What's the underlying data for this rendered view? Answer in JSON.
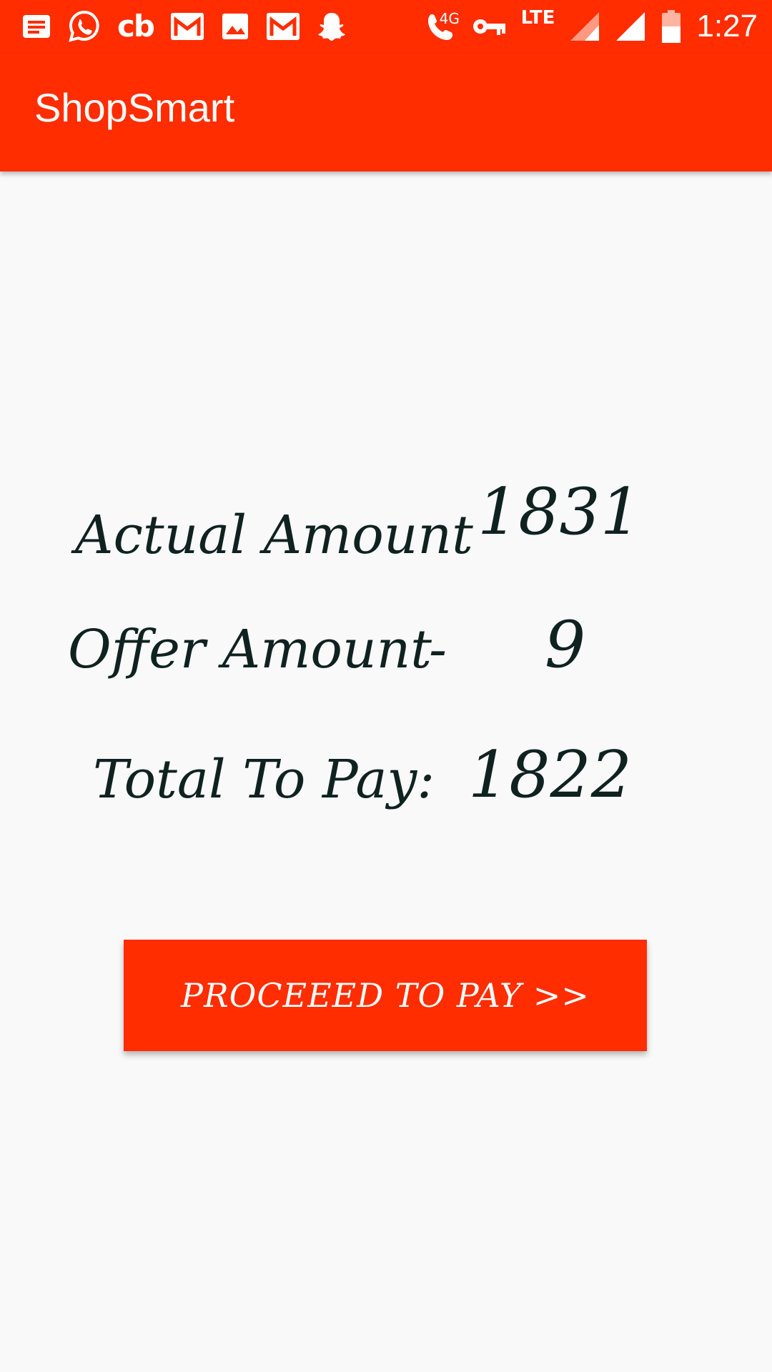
{
  "status_bar": {
    "time": "1:27",
    "network_label": "LTE",
    "call_badge": "4G",
    "left_icons": [
      "message-icon",
      "whatsapp-icon",
      "cb-icon",
      "gmail-icon",
      "image-icon",
      "gmail-icon",
      "snapchat-icon"
    ],
    "right_icons": [
      "wifi-call-icon",
      "vpn-key-icon",
      "signal-icon",
      "signal-full-icon",
      "battery-icon"
    ],
    "cb_text": "cb"
  },
  "toolbar": {
    "title": "ShopSmart",
    "background_color": "#ff2d00"
  },
  "summary": {
    "actual_label": "Actual Amount",
    "actual_value": "1831",
    "offer_label": "Offer Amount",
    "offer_operator": "-",
    "offer_value": "9",
    "total_label": "Total To Pay:",
    "total_value": "1822"
  },
  "pay_button": {
    "label": "PROCEEED TO PAY >>",
    "color": "#ff2d00"
  }
}
